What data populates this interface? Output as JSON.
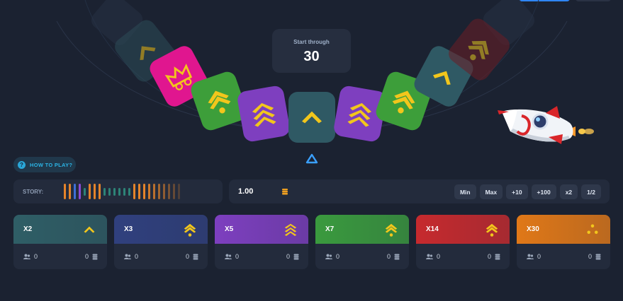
{
  "timer": {
    "label": "Start through",
    "value": "30"
  },
  "how_to_play": {
    "icon": "question-icon",
    "label": "HOW TO PLAY?"
  },
  "story": {
    "label": "STORY:",
    "history": [
      "orange",
      "orange",
      "blue",
      "purple",
      "teal",
      "orange",
      "orange",
      "orange",
      "teal",
      "teal",
      "teal",
      "teal",
      "teal",
      "teal",
      "orange",
      "orange",
      "orange",
      "orange",
      "orange",
      "orange",
      "orange",
      "orange",
      "orange",
      "orange"
    ]
  },
  "bet": {
    "amount": "1.00",
    "icon": "coins-icon",
    "quick_buttons": [
      "Min",
      "Max",
      "+10",
      "+100",
      "x2",
      "1/2"
    ]
  },
  "cards": [
    {
      "multiplier": "X2",
      "players": "0",
      "total": "0",
      "icon": "chevron-icon",
      "color": "#2f5e66"
    },
    {
      "multiplier": "X3",
      "players": "0",
      "total": "0",
      "icon": "chevron-star-icon",
      "color": "#30407e"
    },
    {
      "multiplier": "X5",
      "players": "0",
      "total": "0",
      "icon": "triple-chevron-icon",
      "color": "#7d3fbf"
    },
    {
      "multiplier": "X7",
      "players": "0",
      "total": "0",
      "icon": "chevron-star-icon",
      "color": "#3a9a3e"
    },
    {
      "multiplier": "X14",
      "players": "0",
      "total": "0",
      "icon": "chevron-star-icon",
      "color": "#c62a2e"
    },
    {
      "multiplier": "X30",
      "players": "0",
      "total": "0",
      "icon": "stars-icon",
      "color": "#e07818"
    }
  ],
  "wheel_tiles": [
    {
      "kind": "x2",
      "color": "#2d4c58",
      "icon": "chevron-icon"
    },
    {
      "kind": "x30",
      "color": "#e0168f",
      "icon": "crown-icon"
    },
    {
      "kind": "x7",
      "color": "#3d9e3a",
      "icon": "chevron-star-icon"
    },
    {
      "kind": "x5",
      "color": "#7e3fbf",
      "icon": "triple-chevron-icon"
    },
    {
      "kind": "x2",
      "color": "#2f5964",
      "icon": "chevron-icon"
    },
    {
      "kind": "x5",
      "color": "#7e3fbf",
      "icon": "triple-chevron-icon"
    },
    {
      "kind": "x7",
      "color": "#3d9e3a",
      "icon": "chevron-star-icon"
    },
    {
      "kind": "x2",
      "color": "#2f5964",
      "icon": "chevron-icon"
    },
    {
      "kind": "x14",
      "color": "#6b1d25",
      "icon": "chevron-star-icon"
    }
  ],
  "colors": {
    "orange": "#e5842a",
    "blue": "#3d6fd6",
    "purple": "#8a4bd8",
    "teal": "#2d8377",
    "yellow": "#f2c61c",
    "accent_blue": "#3aa0ff"
  }
}
